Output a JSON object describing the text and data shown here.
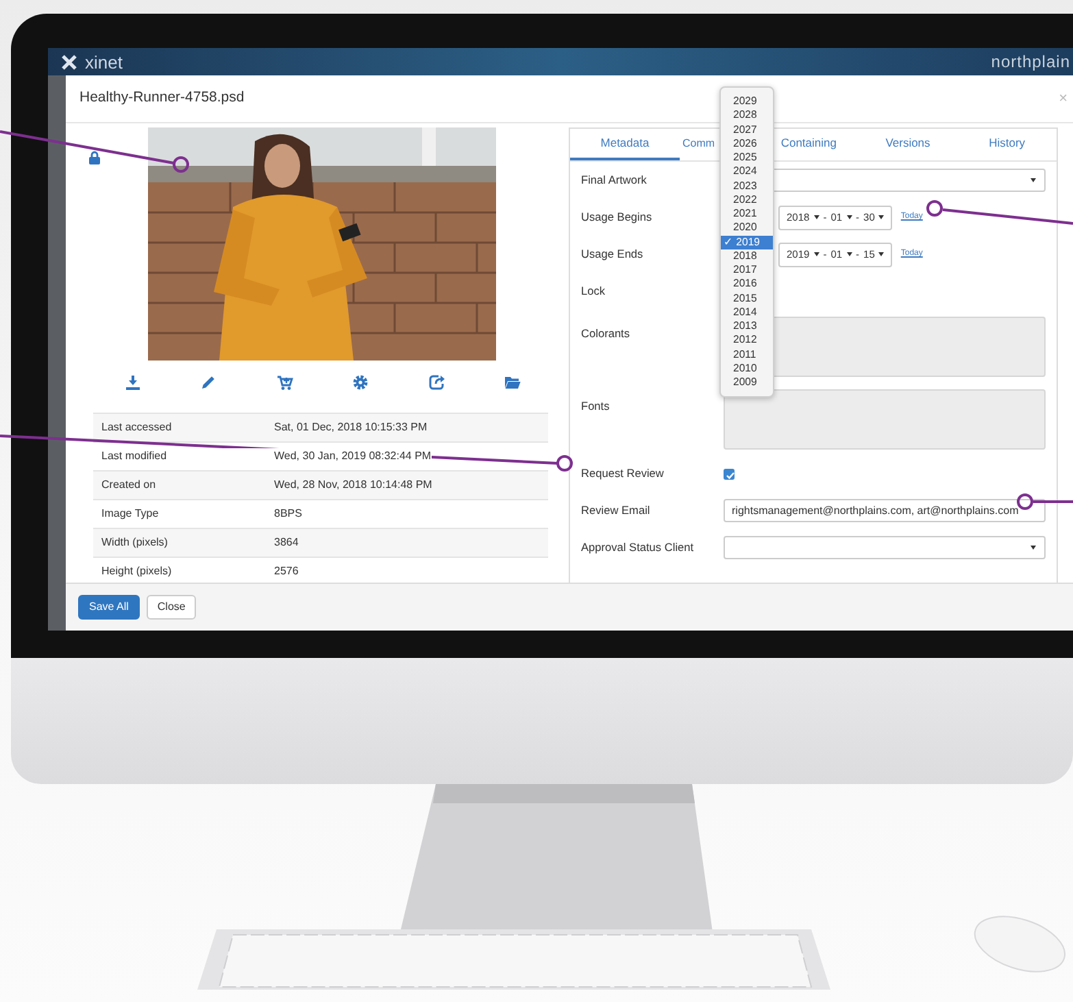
{
  "app_header": {
    "logo": "xinet",
    "brand": "northplain"
  },
  "dialog": {
    "title": "Healthy-Runner-4758.psd",
    "close": "×",
    "preview": {
      "kind": "picture",
      "locked": true
    },
    "properties": [
      {
        "label": "Last accessed",
        "value": "Sat, 01 Dec, 2018 10:15:33 PM"
      },
      {
        "label": "Last modified",
        "value": "Wed, 30 Jan, 2019 08:32:44 PM"
      },
      {
        "label": "Created on",
        "value": "Wed, 28 Nov, 2018 10:14:48 PM"
      },
      {
        "label": "Image Type",
        "value": "8BPS"
      },
      {
        "label": "Width (pixels)",
        "value": "3864"
      },
      {
        "label": "Height (pixels)",
        "value": "2576"
      }
    ],
    "tabs": [
      {
        "label": "Metadata",
        "selected": true
      },
      {
        "label": "Comm",
        "selected": false
      },
      {
        "label": "Containing",
        "selected": false
      },
      {
        "label": "Versions",
        "selected": false
      },
      {
        "label": "History",
        "selected": false
      }
    ],
    "fields": [
      {
        "kind": "select",
        "label": "Final Artwork"
      },
      {
        "kind": "date",
        "label": "Usage Begins",
        "year": "2018",
        "month": "01",
        "day": "30",
        "separator": "-",
        "link": "Today"
      },
      {
        "kind": "date",
        "label": "Usage Ends",
        "year": "2019",
        "month": "01",
        "day": "15",
        "separator": "-",
        "link": "Today"
      },
      {
        "kind": "none",
        "label": "Lock"
      },
      {
        "kind": "textarea",
        "label": "Colorants",
        "disabled": true
      },
      {
        "kind": "textarea",
        "label": "Fonts",
        "disabled": true
      },
      {
        "kind": "checkbox",
        "label": "Request Review",
        "checked": true
      },
      {
        "kind": "text",
        "label": "Review Email",
        "value": "rightsmanagement@northplains.com, art@northplains.com"
      },
      {
        "kind": "select",
        "label": "Approval Status Client"
      }
    ],
    "year_menu": {
      "check": "✓",
      "options": [
        {
          "label": "2029",
          "selected": false
        },
        {
          "label": "2028",
          "selected": false
        },
        {
          "label": "2027",
          "selected": false
        },
        {
          "label": "2026",
          "selected": false
        },
        {
          "label": "2025",
          "selected": false
        },
        {
          "label": "2024",
          "selected": false
        },
        {
          "label": "2023",
          "selected": false
        },
        {
          "label": "2022",
          "selected": false
        },
        {
          "label": "2021",
          "selected": false
        },
        {
          "label": "2020",
          "selected": false
        },
        {
          "label": "2019",
          "selected": true
        },
        {
          "label": "2018",
          "selected": false
        },
        {
          "label": "2017",
          "selected": false
        },
        {
          "label": "2016",
          "selected": false
        },
        {
          "label": "2015",
          "selected": false
        },
        {
          "label": "2014",
          "selected": false
        },
        {
          "label": "2013",
          "selected": false
        },
        {
          "label": "2012",
          "selected": false
        },
        {
          "label": "2011",
          "selected": false
        },
        {
          "label": "2010",
          "selected": false
        },
        {
          "label": "2009",
          "selected": false
        }
      ]
    },
    "buttons": [
      {
        "label": "Save All",
        "primary": true
      },
      {
        "label": "Close",
        "primary": false
      }
    ]
  }
}
